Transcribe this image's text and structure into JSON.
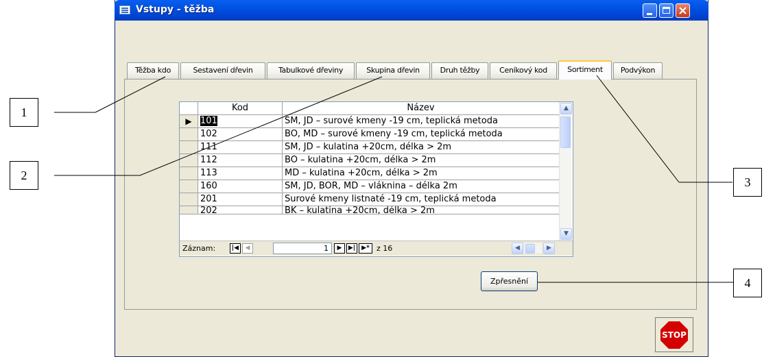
{
  "window": {
    "title": "Vstupy - těžba"
  },
  "tabs": [
    {
      "label": "Těžba kdo"
    },
    {
      "label": "Sestavení dřevin"
    },
    {
      "label": "Tabulkové dřeviny"
    },
    {
      "label": "Skupina dřevin"
    },
    {
      "label": "Druh těžby"
    },
    {
      "label": "Ceníkový kod"
    },
    {
      "label": "Sortiment"
    },
    {
      "label": "Podvýkon"
    }
  ],
  "active_tab": "Sortiment",
  "grid": {
    "columns": [
      "Kod",
      "Název"
    ],
    "rows": [
      {
        "kod": "101",
        "nazev": "SM, JD – surové kmeny -19 cm, teplická metoda"
      },
      {
        "kod": "102",
        "nazev": "BO, MD – surové kmeny -19 cm, teplická metoda"
      },
      {
        "kod": "111",
        "nazev": "SM, JD – kulatina +20cm, délka > 2m"
      },
      {
        "kod": "112",
        "nazev": "BO – kulatina +20cm, délka > 2m"
      },
      {
        "kod": "113",
        "nazev": "MD – kulatina +20cm, délka > 2m"
      },
      {
        "kod": "160",
        "nazev": "SM, JD, BOR, MD – vláknina – délka 2m"
      },
      {
        "kod": "201",
        "nazev": "Surové kmeny listnaté -19 cm, teplická metoda"
      },
      {
        "kod": "202",
        "nazev": "BK – kulatina +20cm, délka > 2m"
      }
    ],
    "current_row_marker": "▶"
  },
  "navigator": {
    "label": "Záznam:",
    "current": "1",
    "total_prefix": "z",
    "total": "16"
  },
  "buttons": {
    "refine": "Zpřesnění",
    "stop": "STOP"
  },
  "callouts": [
    "1",
    "2",
    "3",
    "4"
  ]
}
